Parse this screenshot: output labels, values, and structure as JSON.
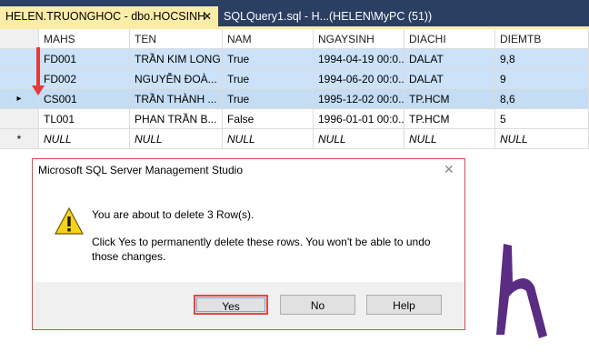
{
  "tabs": [
    {
      "label": "HELEN.TRUONGHOC - dbo.HOCSINH",
      "close": "✕"
    },
    {
      "label": "SQLQuery1.sql - H...(HELEN\\MyPC (51))"
    }
  ],
  "grid": {
    "columns": [
      "MAHS",
      "TEN",
      "NAM",
      "NGAYSINH",
      "DIACHI",
      "DIEMTB"
    ],
    "rows": [
      {
        "marker": "",
        "cells": [
          "FD001",
          "TRẦN KIM LONG",
          "True",
          "1994-04-19 00:0...",
          "DALAT",
          "9,8"
        ]
      },
      {
        "marker": "",
        "cells": [
          "FD002",
          "NGUYỄN ĐOÀ...",
          "True",
          "1994-06-20 00:0...",
          "DALAT",
          "9"
        ]
      },
      {
        "marker": "▸",
        "cells": [
          "CS001",
          "TRẦN THÀNH ...",
          "True",
          "1995-12-02 00:0...",
          "TP.HCM",
          "8,6"
        ]
      },
      {
        "marker": "",
        "cells": [
          "TL001",
          "PHAN TRẦN B...",
          "False",
          "1996-01-01 00:0...",
          "TP.HCM",
          "5"
        ]
      },
      {
        "marker": "*",
        "cells": [
          "NULL",
          "NULL",
          "NULL",
          "NULL",
          "NULL",
          "NULL"
        ]
      }
    ]
  },
  "dialog": {
    "title": "Microsoft SQL Server Management Studio",
    "close": "✕",
    "message": "You are about to delete 3 Row(s).",
    "detail": "Click Yes to permanently delete these rows. You won't be able to undo those changes.",
    "buttons": {
      "yes": "Yes",
      "no": "No",
      "help": "Help"
    }
  },
  "colors": {
    "selected_row": "#cbe2f8",
    "annotation_red": "#e23a3a",
    "logo_purple": "#5a2d82"
  },
  "icons": {
    "dialog": "warning-icon",
    "logo": "h-logo"
  }
}
